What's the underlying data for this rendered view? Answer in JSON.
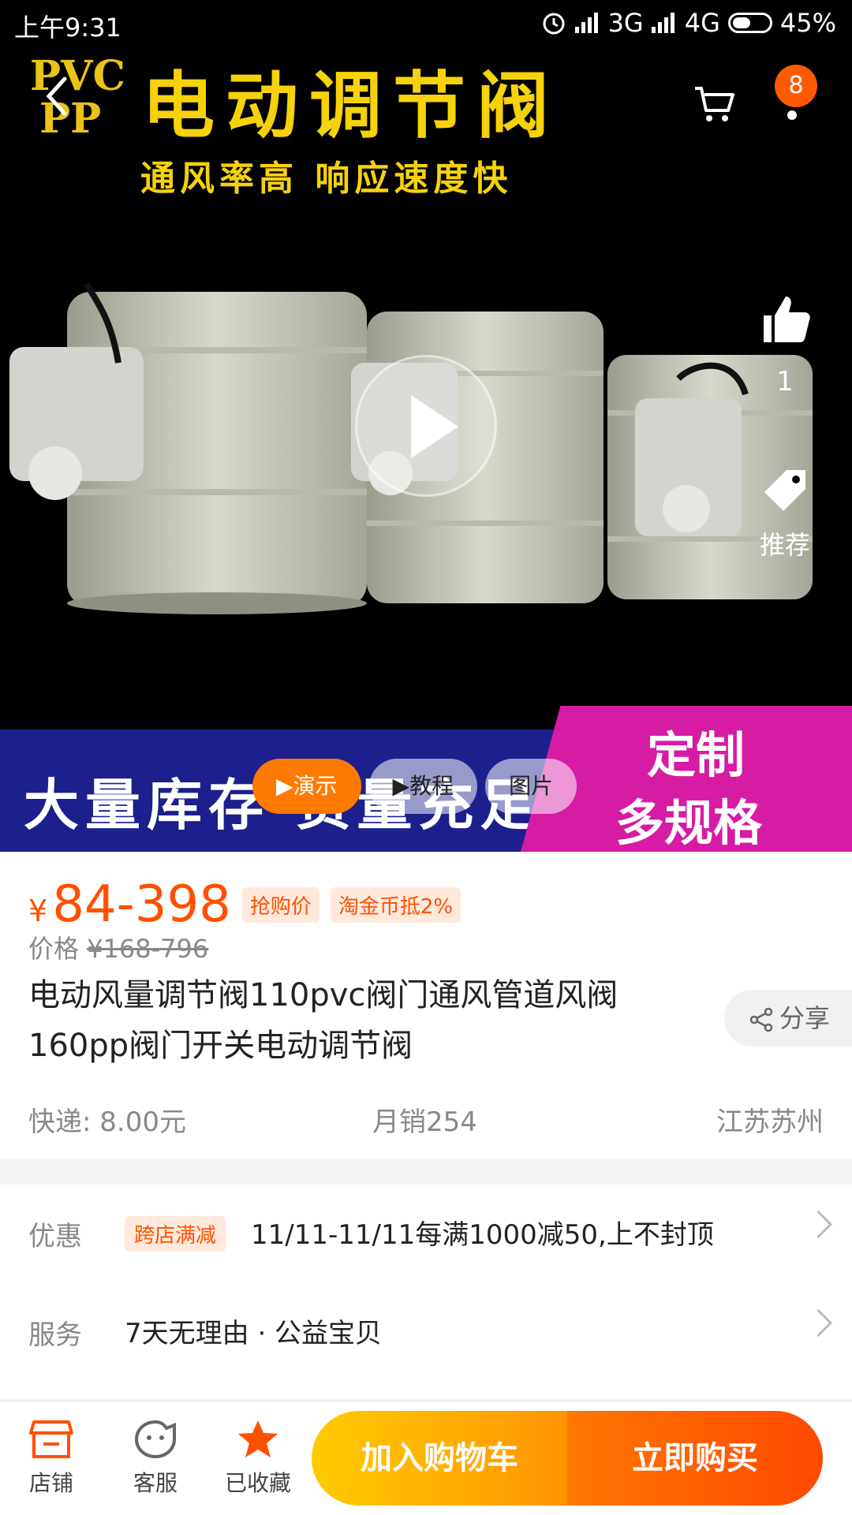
{
  "status_bar": {
    "time": "上午9:31",
    "network_1": "3G",
    "network_2": "4G",
    "battery": "45%"
  },
  "hero": {
    "logo_line1": "PVC",
    "logo_line2": "PP",
    "headline": "电动调节阀",
    "subline": "通风率高 响应速度快",
    "cart_badge": "8",
    "like_count": "1",
    "recommend_label": "推荐",
    "banner_left": "大量库存 货量充足",
    "banner_right_1": "定制",
    "banner_right_2": "多规格",
    "media_tabs": [
      {
        "label": "▶演示",
        "active": true
      },
      {
        "label": "▶教程",
        "active": false
      },
      {
        "label": "图片",
        "active": false
      }
    ]
  },
  "product": {
    "currency": "¥",
    "price": "84-398",
    "price_tag": "抢购价",
    "coin_tag": "淘金币抵2%",
    "orig_label": "价格",
    "orig_price": "¥168-796",
    "title": "电动风量调节阀110pvc阀门通风管道风阀160pp阀门开关电动调节阀",
    "share_label": "分享",
    "shipping": "快递: 8.00元",
    "monthly_sales": "月销254",
    "location": "江苏苏州"
  },
  "promo": {
    "discount_label": "优惠",
    "discount_pill": "跨店满减",
    "discount_text": "11/11-11/11每满1000减50,上不封顶",
    "service_label": "服务",
    "service_text": "7天无理由 · 公益宝贝"
  },
  "bottom_bar": {
    "shop": "店铺",
    "service": "客服",
    "favorite": "已收藏",
    "add_cart": "加入购物车",
    "buy_now": "立即购买"
  },
  "colors": {
    "accent": "#ff5000",
    "banner_blue": "#1c1f8c",
    "banner_pink": "#d61ba4",
    "headline_yellow": "#f5d20a"
  }
}
